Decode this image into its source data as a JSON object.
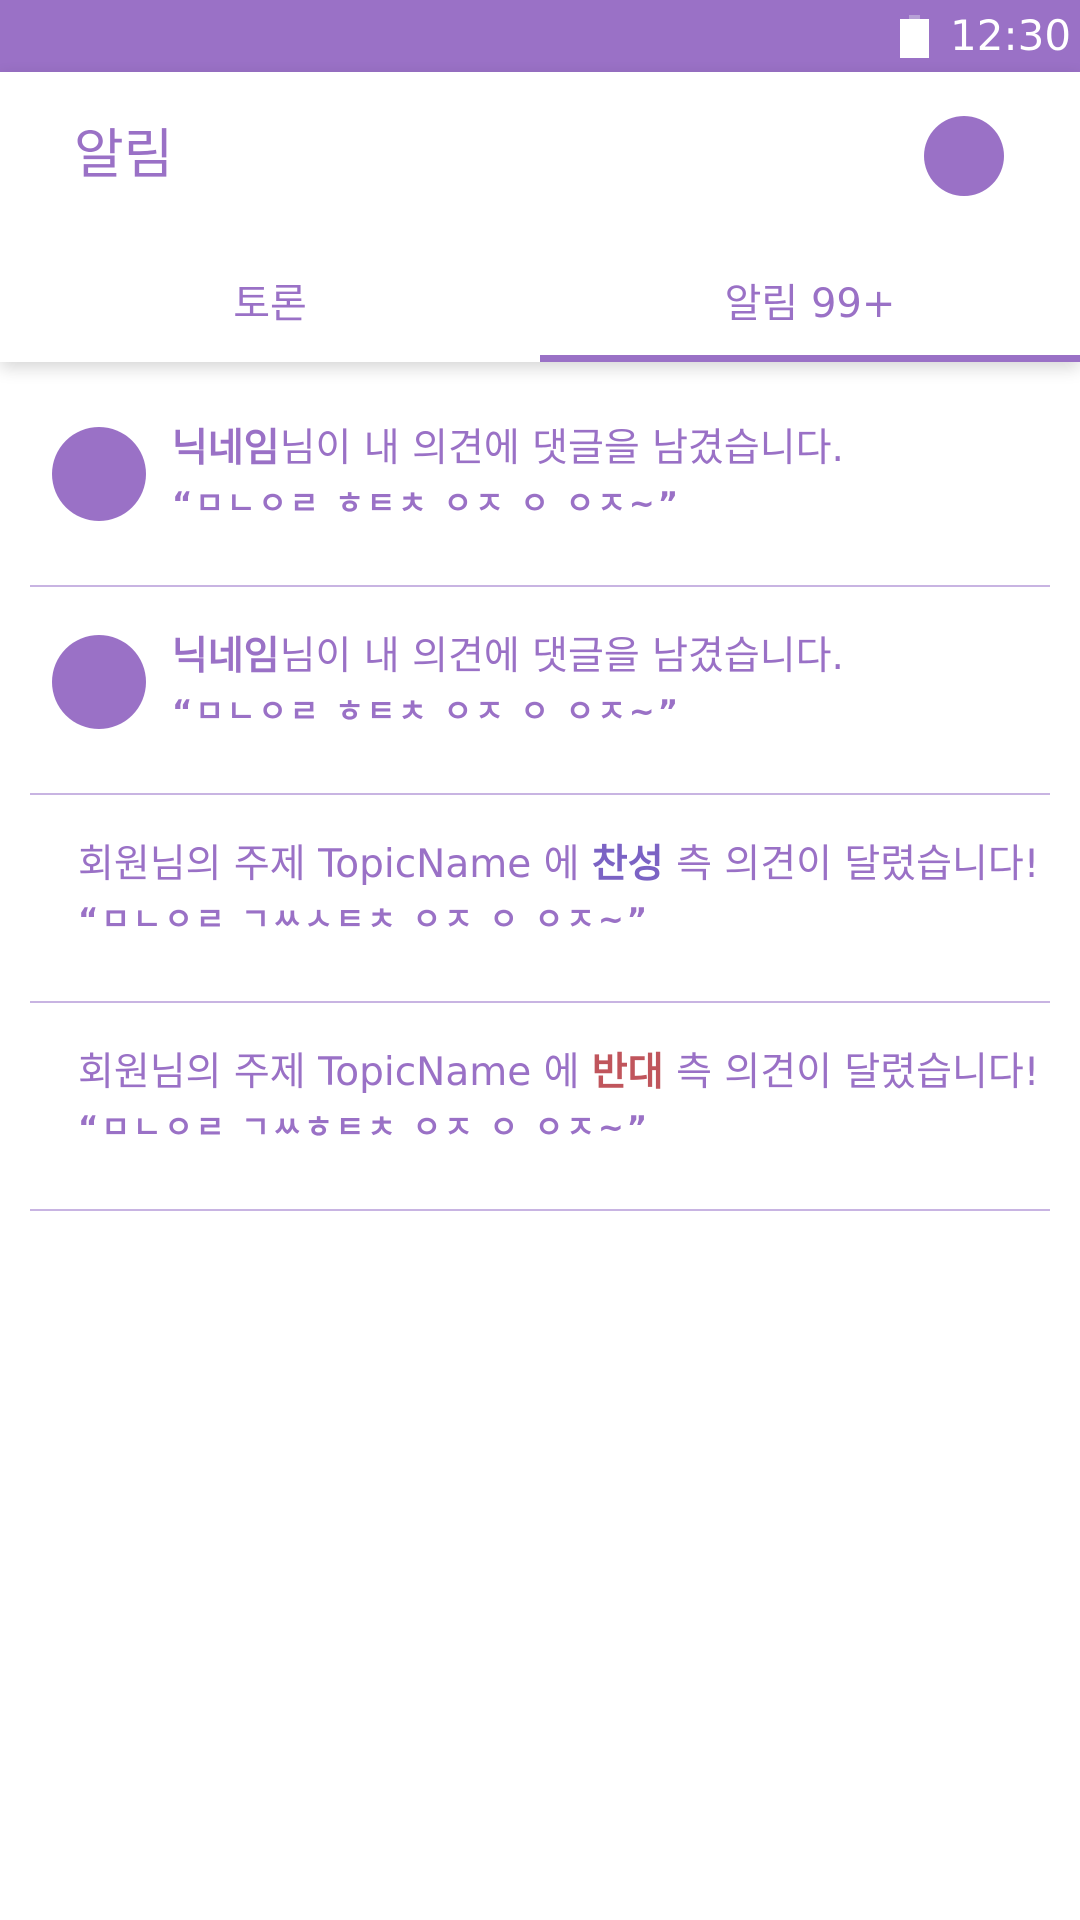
{
  "status_bar": {
    "time": "12:30",
    "battery_icon": "battery-icon"
  },
  "header": {
    "title": "알림",
    "avatar_icon": "profile-avatar"
  },
  "tabs": [
    {
      "label": "토론",
      "selected": false
    },
    {
      "label": "알림 99+",
      "selected": true
    }
  ],
  "colors": {
    "accent": "#9a71c6",
    "pro": "#7b63c4",
    "con": "#c0555c",
    "divider": "#c8b4e2"
  },
  "notifications": [
    {
      "nickname": "닉네임",
      "message": "님이 내 의견에 댓글을 남겼습니다.",
      "quote": "“ㅁㄴㅇㄹ ㅎㅌㅊ ㅇㅈ ㅇ ㅇㅈ~”"
    },
    {
      "nickname": "닉네임",
      "message": "님이 내 의견에 댓글을 남겼습니다.",
      "quote": "“ㅁㄴㅇㄹ ㅎㅌㅊ ㅇㅈ ㅇ ㅇㅈ~”"
    },
    {
      "prefix": "회원님의 주제 ",
      "topic": "TopicName",
      "connector": " 에 ",
      "side": "찬성",
      "suffix": " 측 의견이 달렸습니다!",
      "quote": "“ㅁㄴㅇㄹ ㄱㅆㅅㅌㅊ ㅇㅈ ㅇ ㅇㅈ~”"
    },
    {
      "prefix": "회원님의 주제 ",
      "topic": "TopicName",
      "connector": " 에 ",
      "side": "반대",
      "suffix": " 측 의견이 달렸습니다!",
      "quote": "“ㅁㄴㅇㄹ ㄱㅆㅎㅌㅊ ㅇㅈ ㅇ ㅇㅈ~”"
    }
  ]
}
